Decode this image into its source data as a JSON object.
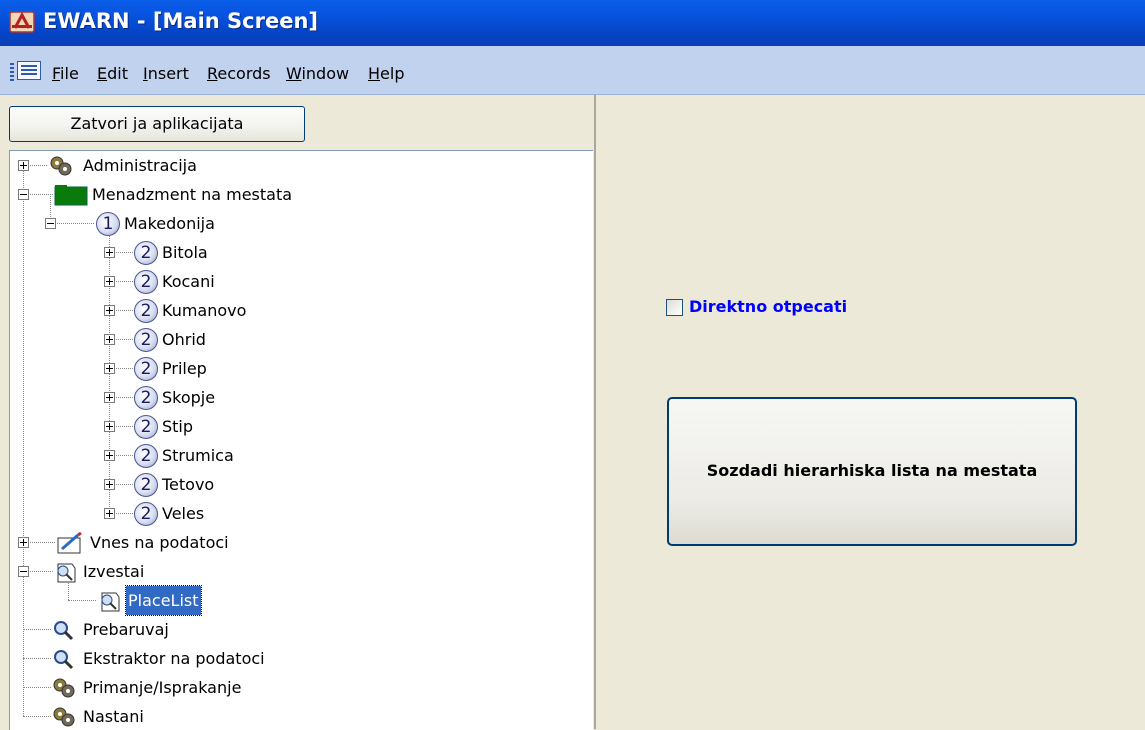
{
  "window": {
    "title": "EWARN - [Main Screen]",
    "icon": "access-form-icon"
  },
  "menu": [
    {
      "label": "File",
      "accel": "F"
    },
    {
      "label": "Edit",
      "accel": "E"
    },
    {
      "label": "Insert",
      "accel": "I"
    },
    {
      "label": "Records",
      "accel": "R"
    },
    {
      "label": "Window",
      "accel": "W"
    },
    {
      "label": "Help",
      "accel": "H"
    }
  ],
  "left": {
    "close_button": "Zatvori ja aplikacijata",
    "tree": {
      "administracija": "Administracija",
      "menadzment": "Menadzment na mestata",
      "makedonija": {
        "label": "Makedonija",
        "level": "1"
      },
      "cities": [
        {
          "label": "Bitola",
          "level": "2"
        },
        {
          "label": "Kocani",
          "level": "2"
        },
        {
          "label": "Kumanovo",
          "level": "2"
        },
        {
          "label": "Ohrid",
          "level": "2"
        },
        {
          "label": "Prilep",
          "level": "2"
        },
        {
          "label": "Skopje",
          "level": "2"
        },
        {
          "label": "Stip",
          "level": "2"
        },
        {
          "label": "Strumica",
          "level": "2"
        },
        {
          "label": "Tetovo",
          "level": "2"
        },
        {
          "label": "Veles",
          "level": "2"
        }
      ],
      "vnes": "Vnes na podatoci",
      "izvestai": "Izvestai",
      "placelist": "PlaceList",
      "prebaruvaj": "Prebaruvaj",
      "ekstraktor": "Ekstraktor na podatoci",
      "primanje": "Primanje/Isprakanje",
      "nastani": "Nastani"
    }
  },
  "right": {
    "checkbox_label": "Direktno otpecati",
    "checkbox_checked": false,
    "main_button": "Sozdadi hierarhiska lista na mestata"
  }
}
